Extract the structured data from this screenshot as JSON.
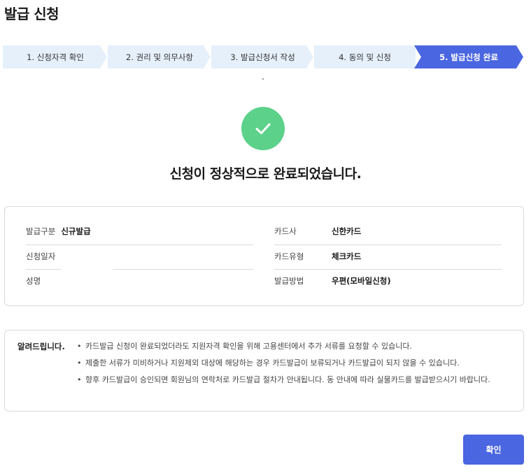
{
  "header": {
    "title": "발급 신청"
  },
  "steps": [
    {
      "label": "1. 신청자격 확인"
    },
    {
      "label": "2. 권리 및 의무사항"
    },
    {
      "label": "3. 발급신청서 작성"
    },
    {
      "label": "4. 동의 및 신청"
    },
    {
      "label": "5. 발급신청 완료"
    }
  ],
  "active_step": 5,
  "colors": {
    "step_bg": "#e5f0fb",
    "step_active": "#4a66e0",
    "check": "#5cd18a",
    "button": "#4a66e0"
  },
  "icons": {
    "success": "check-icon"
  },
  "result": {
    "message": "신청이 정상적으로 완료되었습니다."
  },
  "info": {
    "issue_type_label": "발급구분",
    "issue_type_value": "신규발급",
    "apply_date_label": "신청일자",
    "apply_date_value": "",
    "name_label": "성명",
    "name_value": "",
    "card_company_label": "카드사",
    "card_company_value": "신한카드",
    "card_type_label": "카드유형",
    "card_type_value": "체크카드",
    "issue_method_label": "발급방법",
    "issue_method_value": "우편(모바일신청)"
  },
  "notice": {
    "title": "알려드립니다.",
    "items": [
      "카드발급 신청이 완료되었더라도 지원자격 확인을 위해 고용센터에서 추가 서류를 요청할 수 있습니다.",
      "제출한 서류가 미비하거나 지원제외 대상에 해당하는 경우 카드발급이 보류되거나 카드발급이 되지 않을 수 있습니다.",
      "향후 카드발급이 승인되면 회원님의 연락처로 카드발급 절차가 안내됩니다. 동 안내에 따라 실물카드를 발급받으시기 바랍니다."
    ]
  },
  "actions": {
    "confirm_label": "확인"
  }
}
